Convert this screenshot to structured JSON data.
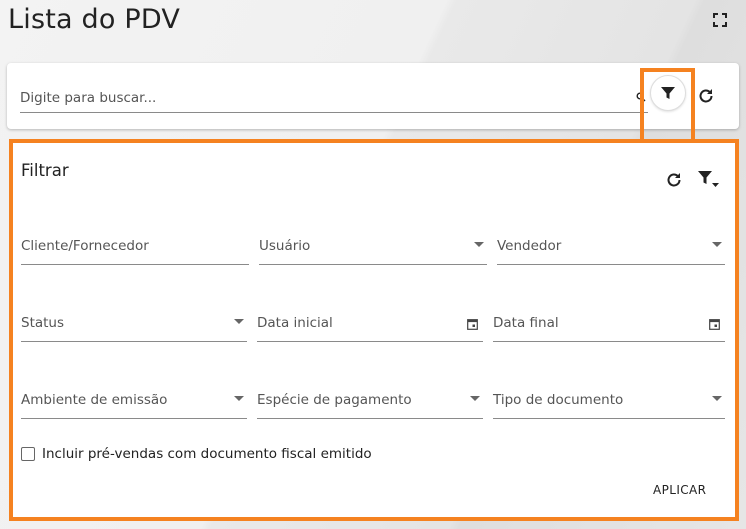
{
  "page": {
    "title": "Lista do PDV"
  },
  "search": {
    "placeholder": "Digite para buscar..."
  },
  "filter_panel": {
    "title": "Filtrar",
    "fields": {
      "cliente": "Cliente/Fornecedor",
      "usuario": "Usuário",
      "vendedor": "Vendedor",
      "status": "Status",
      "data_inicial": "Data inicial",
      "data_final": "Data final",
      "ambiente": "Ambiente de emissão",
      "especie": "Espécie de pagamento",
      "tipo": "Tipo de documento"
    },
    "checkbox_label": "Incluir pré-vendas com documento fiscal emitido",
    "apply_label": "APLICAR"
  },
  "colors": {
    "highlight": "#f58220",
    "underline": "#8a8a8a"
  },
  "icons": [
    "fullscreen-icon",
    "search-icon",
    "filter-icon",
    "refresh-icon",
    "filter-menu-icon",
    "calendar-icon",
    "dropdown-arrow-icon"
  ]
}
